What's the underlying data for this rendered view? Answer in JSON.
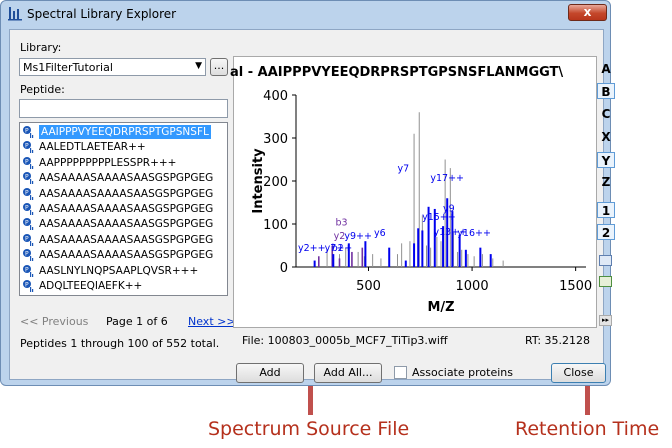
{
  "window": {
    "title": "Spectral Library Explorer",
    "close_glyph": "x"
  },
  "library": {
    "label": "Library:",
    "value": "Ms1FilterTutorial",
    "browse_label": "..."
  },
  "peptide": {
    "label": "Peptide:",
    "search_value": ""
  },
  "peptides": [
    {
      "text": "AAIPPPVYEEQDRPRSPTGPSNSFL",
      "selected": true,
      "underline_char": ""
    },
    {
      "text": "AALEDTLAETEAR++",
      "selected": false
    },
    {
      "text": "AAPPPPPPPPPLESSPR+++",
      "selected": false
    },
    {
      "text": "AASAAAASAAAASAASGSPGPGEG",
      "selected": false
    },
    {
      "text": "AASAAAASAAAASAASGSPGPGEG",
      "selected": false
    },
    {
      "text": "AASAAAASAAAASAASGSPGPGEG",
      "selected": false
    },
    {
      "text": "AASAAAASAAAASAASGSPGPGEG",
      "selected": false
    },
    {
      "text": "AASAAAASAAAASAASGSPGPGEG",
      "selected": false
    },
    {
      "text": "AASAAAASAAAASAASGSPGPGEG",
      "selected": false
    },
    {
      "text": "AASLNYLNQPSAAPLQVSR+++",
      "selected": false
    },
    {
      "text": "ADQLTEEQIAEFK++",
      "selected": false
    }
  ],
  "pager": {
    "prev": "<< Previous",
    "page": "Page 1 of 6",
    "next": "Next >>",
    "summary": "Peptides 1 through 100 of 552 total."
  },
  "spectrum": {
    "title": "al - AAIPPPVYEEQDRPRSPTGPSNSFLANMGGT\\",
    "file_label": "File: 100803_0005b_MCF7_TiTip3.wiff",
    "rt_label": "RT: 35.2128"
  },
  "ion_buttons": [
    {
      "label": "A",
      "on": false
    },
    {
      "label": "B",
      "on": true
    },
    {
      "label": "C",
      "on": false
    },
    {
      "label": "X",
      "on": false
    },
    {
      "label": "Y",
      "on": true
    },
    {
      "label": "Z",
      "on": false
    },
    {
      "label": "1",
      "on": true
    },
    {
      "label": "2",
      "on": true
    }
  ],
  "buttons": {
    "add": "Add",
    "add_all": "Add All...",
    "associate": "Associate proteins",
    "close": "Close"
  },
  "annotations": {
    "source_file": "Spectrum Source File",
    "retention_time": "Retention Time"
  },
  "chart_data": {
    "type": "bar",
    "xlabel": "M/Z",
    "ylabel": "Intensity",
    "xlim": [
      150,
      1550
    ],
    "ylim": [
      0,
      400
    ],
    "xticks": [
      500,
      1000,
      1500
    ],
    "yticks": [
      0,
      100,
      200,
      300,
      400
    ],
    "colors": {
      "gray": "#909090",
      "b_ion": "#7030a0",
      "y_ion": "#0000ee"
    },
    "peaks_gray": [
      [
        300,
        40
      ],
      [
        330,
        25
      ],
      [
        360,
        30
      ],
      [
        390,
        45
      ],
      [
        420,
        20
      ],
      [
        450,
        35
      ],
      [
        480,
        25
      ],
      [
        520,
        30
      ],
      [
        560,
        20
      ],
      [
        600,
        40
      ],
      [
        640,
        30
      ],
      [
        660,
        55
      ],
      [
        700,
        60
      ],
      [
        720,
        310
      ],
      [
        745,
        360
      ],
      [
        760,
        120
      ],
      [
        780,
        50
      ],
      [
        800,
        45
      ],
      [
        830,
        70
      ],
      [
        850,
        60
      ],
      [
        870,
        250
      ],
      [
        895,
        230
      ],
      [
        910,
        80
      ],
      [
        930,
        35
      ],
      [
        950,
        40
      ],
      [
        980,
        30
      ],
      [
        1010,
        25
      ],
      [
        1050,
        30
      ],
      [
        1100,
        20
      ],
      [
        1150,
        15
      ]
    ],
    "peaks_b": [
      [
        260,
        25
      ],
      [
        325,
        50
      ],
      [
        360,
        20
      ],
      [
        420,
        35
      ],
      [
        470,
        45
      ]
    ],
    "peaks_y": [
      [
        240,
        15
      ],
      [
        330,
        30
      ],
      [
        405,
        55
      ],
      [
        485,
        60
      ],
      [
        600,
        45
      ],
      [
        680,
        15
      ],
      [
        720,
        55
      ],
      [
        740,
        90
      ],
      [
        760,
        85
      ],
      [
        790,
        140
      ],
      [
        820,
        135
      ],
      [
        860,
        95
      ],
      [
        880,
        160
      ],
      [
        905,
        130
      ],
      [
        940,
        75
      ],
      [
        970,
        40
      ],
      [
        1040,
        45
      ],
      [
        1090,
        30
      ]
    ],
    "labels": [
      {
        "text": "y7",
        "x": 668,
        "y": 217,
        "c": "y"
      },
      {
        "text": "y17++",
        "x": 880,
        "y": 195,
        "c": "y"
      },
      {
        "text": "y9",
        "x": 888,
        "y": 125,
        "c": "y"
      },
      {
        "text": "y15++",
        "x": 840,
        "y": 105,
        "c": "y"
      },
      {
        "text": "b3",
        "x": 370,
        "y": 92,
        "c": "b"
      },
      {
        "text": "y6",
        "x": 555,
        "y": 67,
        "c": "y"
      },
      {
        "text": "y13++",
        "x": 895,
        "y": 70,
        "c": "y"
      },
      {
        "text": "y16++",
        "x": 1010,
        "y": 67,
        "c": "y"
      },
      {
        "text": "y9++",
        "x": 450,
        "y": 60,
        "c": "y"
      },
      {
        "text": "y2",
        "x": 360,
        "y": 60,
        "c": "b"
      },
      {
        "text": "y2++, b2",
        "x": 270,
        "y": 32,
        "c": "y"
      },
      {
        "text": "y7++",
        "x": 355,
        "y": 32,
        "c": "y"
      }
    ]
  }
}
